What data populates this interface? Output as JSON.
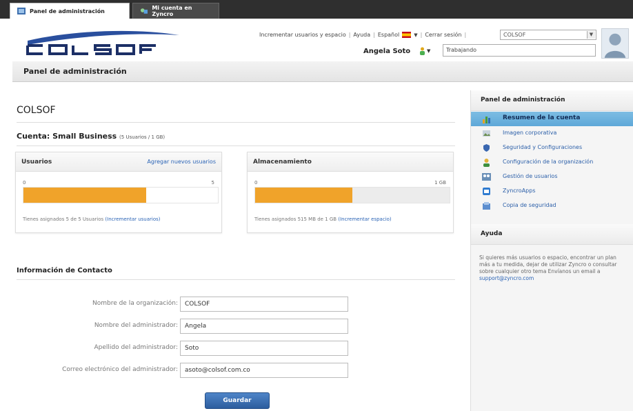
{
  "tabs": {
    "active": "Panel de administración",
    "other": "Mi cuenta en Zyncro"
  },
  "header": {
    "links": {
      "increase": "Incrementar usuarios y espacio",
      "help": "Ayuda",
      "language": "Español",
      "logout": "Cerrar sesión"
    },
    "org_select": "COLSOF",
    "user_name": "Angela Soto",
    "status_value": "Trabajando"
  },
  "page": {
    "title": "Panel de administración",
    "org_name": "COLSOF",
    "account_label": "Cuenta: Small Business",
    "account_detail": "(5 Usuarios / 1 GB)"
  },
  "users_card": {
    "title": "Usuarios",
    "link": "Agregar nuevos usuarios",
    "min": "0",
    "max": "5",
    "fill_fraction": 0.63,
    "footer_text": "Tienes asignados 5 de 5 Usuarios",
    "footer_link": "(Incrementar usuarios)"
  },
  "storage_card": {
    "title": "Almacenamiento",
    "min": "0",
    "max": "1 GB",
    "fill_fraction": 0.5,
    "footer_text": "Tienes asignados 515 MB de 1 GB",
    "footer_link": "(Incrementar espacio)"
  },
  "contact": {
    "title": "Información de Contacto",
    "fields": [
      {
        "label": "Nombre de la organización:",
        "value": "COLSOF"
      },
      {
        "label": "Nombre del administrador:",
        "value": "Angela"
      },
      {
        "label": "Apellido del administrador:",
        "value": "Soto"
      },
      {
        "label": "Correo electrónico del administrador:",
        "value": "asoto@colsof.com.co"
      }
    ],
    "save_label": "Guardar"
  },
  "sidebar": {
    "heading": "Panel de administración",
    "items": [
      {
        "label": "Resumen de la cuenta",
        "icon": "chart-icon"
      },
      {
        "label": "Imagen corporativa",
        "icon": "image-icon"
      },
      {
        "label": "Seguridad y Configuraciones",
        "icon": "shield-icon"
      },
      {
        "label": "Configuración de la organización",
        "icon": "org-icon"
      },
      {
        "label": "Gestión de usuarios",
        "icon": "users-icon"
      },
      {
        "label": "ZyncroApps",
        "icon": "apps-icon"
      },
      {
        "label": "Copia de seguridad",
        "icon": "backup-icon"
      }
    ],
    "help_heading": "Ayuda",
    "help_text": "Si quieres más usuarios o espacio, encontrar un plan más a tu medida, dejar de utilizar Zyncro o consultar sobre cualquier otro tema Envíanos un email a",
    "help_email": "support@zyncro.com"
  },
  "colors": {
    "bar_fill": "#f0a32a",
    "active_item": "#6db3df",
    "primary_button": "#2c5d9e",
    "link": "#2a63b5"
  }
}
